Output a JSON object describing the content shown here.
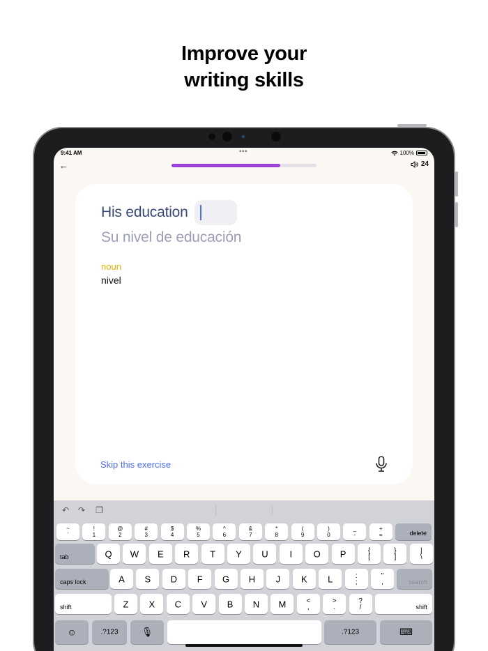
{
  "headline": [
    "Improve your",
    "writing skills"
  ],
  "status_bar": {
    "time": "9:41 AM",
    "dots": "•••",
    "battery_percent": "100%"
  },
  "top_bar": {
    "progress": 0.75,
    "sound_count": "24"
  },
  "exercise": {
    "sentence": "His education",
    "translation": "Su nivel de educación",
    "part_of_speech": "noun",
    "hint_word": "nivel",
    "skip_label": "Skip this exercise"
  },
  "keyboard": {
    "row1": [
      {
        "top": "~",
        "bot": "`"
      },
      {
        "top": "!",
        "bot": "1"
      },
      {
        "top": "@",
        "bot": "2"
      },
      {
        "top": "#",
        "bot": "3"
      },
      {
        "top": "$",
        "bot": "4"
      },
      {
        "top": "%",
        "bot": "5"
      },
      {
        "top": "^",
        "bot": "6"
      },
      {
        "top": "&",
        "bot": "7"
      },
      {
        "top": "*",
        "bot": "8"
      },
      {
        "top": "(",
        "bot": "9"
      },
      {
        "top": ")",
        "bot": "0"
      },
      {
        "top": "_",
        "bot": "-"
      },
      {
        "top": "+",
        "bot": "="
      }
    ],
    "delete_label": "delete",
    "tab_label": "tab",
    "row2": [
      "Q",
      "W",
      "E",
      "R",
      "T",
      "Y",
      "U",
      "I",
      "O",
      "P"
    ],
    "row2_extra": [
      {
        "top": "{",
        "bot": "["
      },
      {
        "top": "}",
        "bot": "]"
      },
      {
        "top": "|",
        "bot": "\\"
      }
    ],
    "caps_label": "caps lock",
    "row3": [
      "A",
      "S",
      "D",
      "F",
      "G",
      "H",
      "J",
      "K",
      "L"
    ],
    "row3_extra": [
      {
        "top": ":",
        "bot": ";"
      },
      {
        "top": "\"",
        "bot": ","
      }
    ],
    "search_label": "search",
    "shift_label": "shift",
    "row4": [
      "Z",
      "X",
      "C",
      "V",
      "B",
      "N",
      "M"
    ],
    "row4_extra": [
      {
        "top": "<",
        "bot": ","
      },
      {
        "top": ">",
        "bot": "."
      },
      {
        "top": "?",
        "bot": "/"
      }
    ],
    "num_label": ".?123"
  }
}
